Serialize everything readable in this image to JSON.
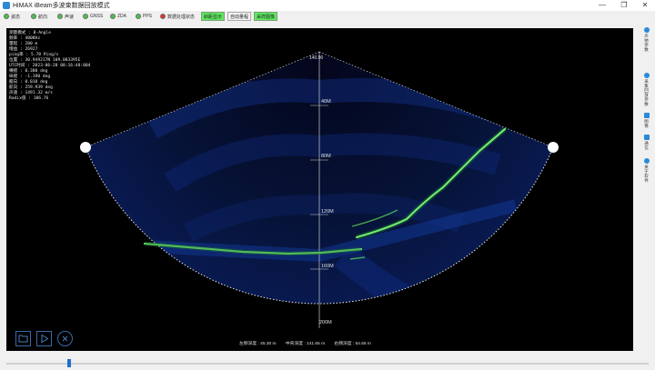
{
  "window": {
    "title": "HiMAX iBeam多波束数据回放模式",
    "minimize": "—",
    "maximize": "❐",
    "close": "✕"
  },
  "toolbar": {
    "status_items": [
      "姿态",
      "航向",
      "声速",
      "GNSS",
      "ZDA",
      "PPS"
    ],
    "data_status": "数据处理状态",
    "buttons": {
      "slant": "斜距显示",
      "auto_gain": "自动量程",
      "record": "采样图像"
    }
  },
  "sonar": {
    "info_lines": [
      "测量模式 : B-Angle",
      "频率 : 400KHz",
      "量程 : 200 m",
      "增益 : 26927",
      "ping率 : 5.78 Ping/s",
      "位置 : 30.949217N  109.083395E",
      "UTC时间 : 2023-06-28 08:16:48:004",
      "横摇 : 0.380 deg",
      "纵摇 : -1.190 deg",
      "艏向 : 0.010 deg",
      "航向 : 259.939 deg",
      "声速 : 1491.32 m/s",
      "Radix值 : 106.76"
    ],
    "scale": {
      "top": "140.90",
      "ticks": [
        "40M",
        "80M",
        "120M",
        "160M",
        "200M"
      ]
    },
    "depths": {
      "left": "左侧深度 : 45.30 m",
      "center": "中央深度 : 141.65 m",
      "right": "右侧深度 : 54.55 m"
    }
  },
  "sidebar": {
    "items": [
      {
        "label": "声纳参数"
      },
      {
        "label": "采集回放参数"
      },
      {
        "label": "图像"
      },
      {
        "label": "通信"
      },
      {
        "label": "关于软件"
      }
    ]
  },
  "playback": {
    "position": 0.098
  },
  "colors": {
    "swath_green": "#6fe86f",
    "led_green": "#47c447",
    "accent_blue": "#1e6fd0"
  }
}
